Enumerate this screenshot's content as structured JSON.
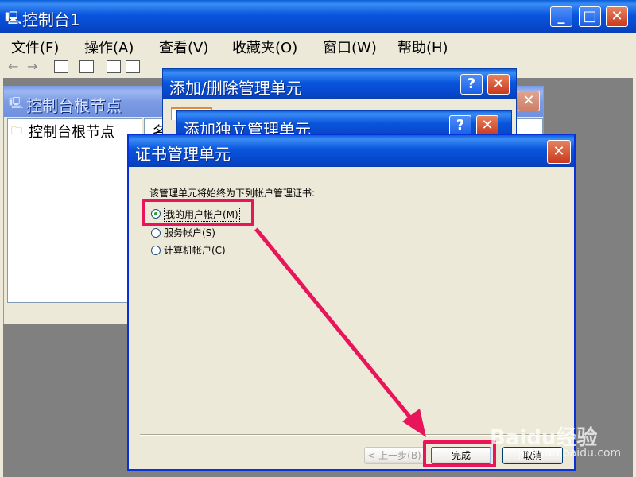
{
  "main_window": {
    "title": "控制台1",
    "menu": [
      "文件(F)",
      "操作(A)",
      "查看(V)",
      "收藏夹(O)",
      "窗口(W)",
      "帮助(H)"
    ]
  },
  "root_window": {
    "title": "控制台根节点",
    "tree_item": "控制台根节点",
    "column_header": "名"
  },
  "add_remove_dialog": {
    "title": "添加/删除管理单元"
  },
  "standalone_dialog": {
    "title": "添加独立管理单元"
  },
  "cert_dialog": {
    "title": "证书管理单元",
    "prompt": "该管理单元将始终为下列帐户管理证书:",
    "options": [
      "我的用户帐户(M)",
      "服务帐户(S)",
      "计算机帐户(C)"
    ],
    "selected_index": 0,
    "buttons": {
      "back": "< 上一步(B)",
      "finish": "完成",
      "cancel": "取消"
    }
  },
  "watermark": {
    "brand": "Baidu经验",
    "url": "jingyan.baidu.com"
  },
  "colors": {
    "xp_title_blue": "#0855dd",
    "dialog_face": "#ece9d8",
    "highlight": "#e8155a"
  }
}
